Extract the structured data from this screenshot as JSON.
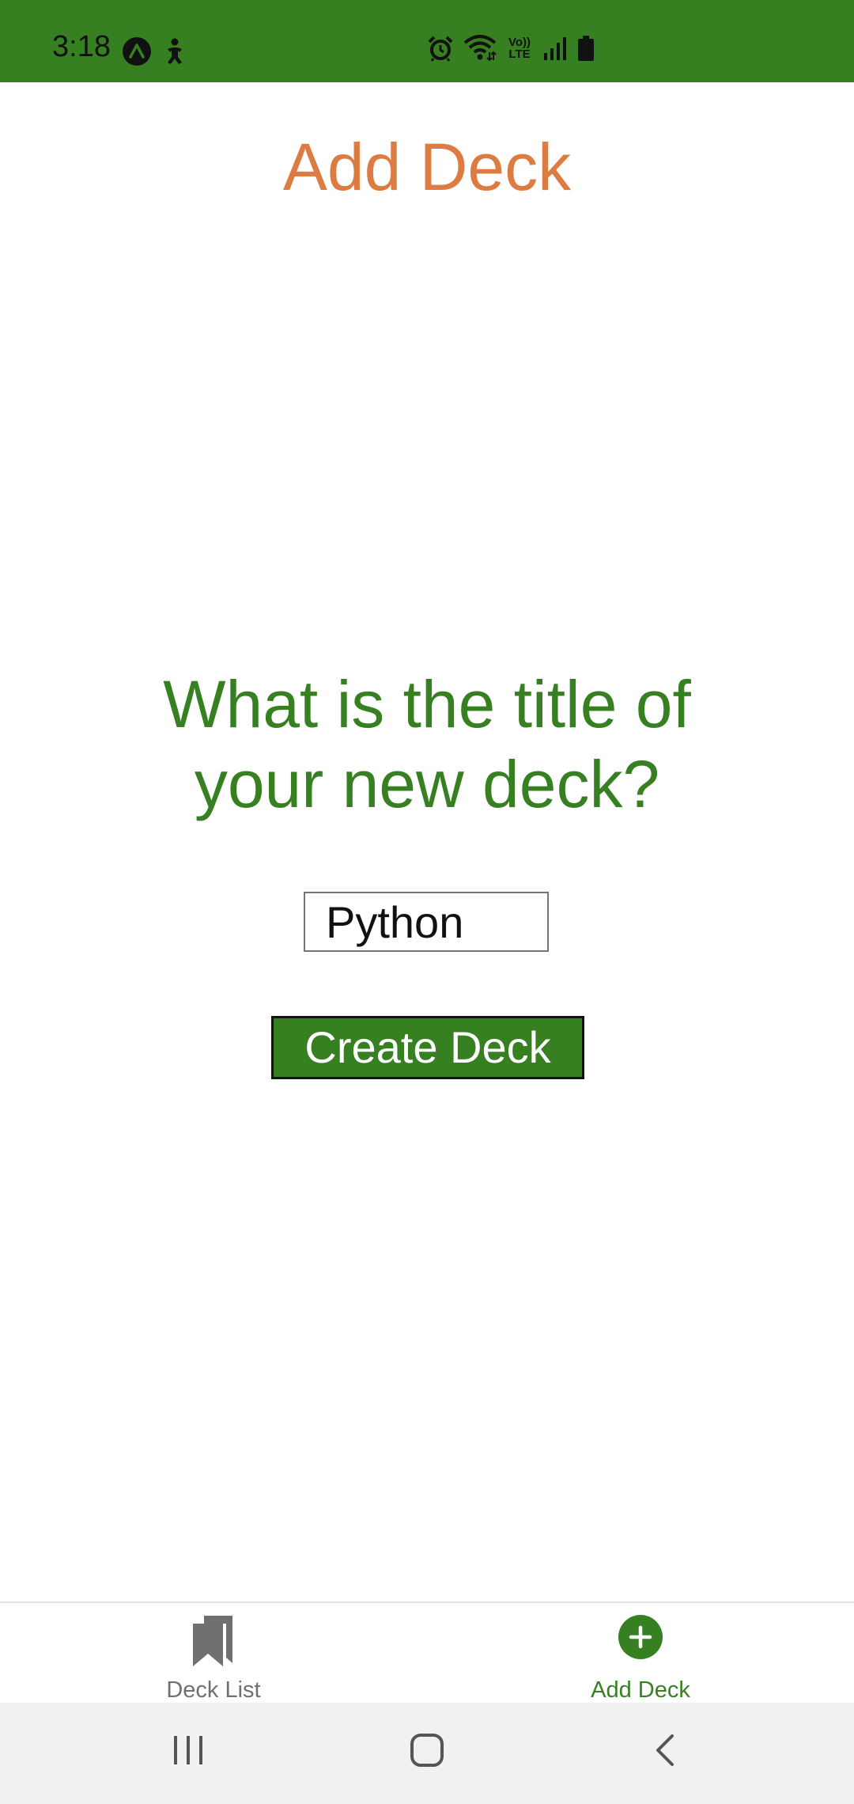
{
  "status_bar": {
    "time": "3:18",
    "background_color": "#378022",
    "icons": [
      "app-a-icon",
      "accessibility-icon",
      "alarm-icon",
      "wifi-icon",
      "volte-icon",
      "signal-icon",
      "battery-icon"
    ],
    "volte_line1": "Vo))",
    "volte_line2": "LTE"
  },
  "header": {
    "title": "Add Deck",
    "title_color": "#dd7c42"
  },
  "main": {
    "question": "What is the title of your new deck?",
    "question_color": "#378022",
    "title_input": {
      "value": "Python",
      "placeholder": ""
    },
    "create_button_label": "Create Deck",
    "button_color": "#378022"
  },
  "tab_bar": {
    "tabs": [
      {
        "label": "Deck List",
        "icon": "bookmarks-icon",
        "active": false
      },
      {
        "label": "Add Deck",
        "icon": "plus-circle-icon",
        "active": true
      }
    ],
    "active_color": "#378022",
    "inactive_color": "#707070"
  },
  "nav_bar": {
    "buttons": [
      "recent-apps-icon",
      "home-icon",
      "back-icon"
    ]
  }
}
